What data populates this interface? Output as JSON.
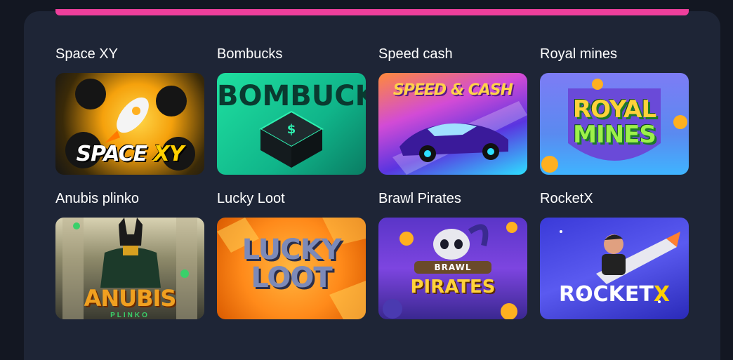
{
  "games": [
    {
      "title": "Space XY",
      "logo": "SPACE",
      "logo_accent": "XY"
    },
    {
      "title": "Bombucks",
      "logo": "BOMBUCKS"
    },
    {
      "title": "Speed cash",
      "logo": "SPEED & CASH"
    },
    {
      "title": "Royal mines",
      "logo": "ROYAL",
      "logo_accent": "MINES"
    },
    {
      "title": "Anubis plinko",
      "logo": "ANUBIS",
      "logo_sub": "PLINKO"
    },
    {
      "title": "Lucky Loot",
      "logo": "LUCKY",
      "logo_accent": "LOOT"
    },
    {
      "title": "Brawl Pirates",
      "logo": "BRAWL",
      "logo_accent": "PIRATES"
    },
    {
      "title": "RocketX",
      "logo": "ROCKET",
      "logo_accent": "X"
    }
  ],
  "colors": {
    "background": "#131722",
    "panel": "#1e2536",
    "accent_bar": "#ee3f9c"
  }
}
